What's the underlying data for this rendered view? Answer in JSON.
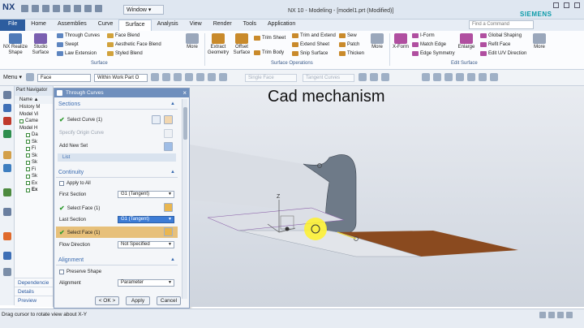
{
  "app": {
    "logo": "NX",
    "window_menu": "Window ▾",
    "title": "NX 10 - Modeling - [model1.prt (Modified)]",
    "brand": "SIEMENS",
    "search_placeholder": "Find a Command"
  },
  "tabs": [
    "File",
    "Home",
    "Assemblies",
    "Curve",
    "Surface",
    "Analysis",
    "View",
    "Render",
    "Tools",
    "Application"
  ],
  "ribbon": {
    "nx_realize": "NX Realize Shape",
    "studio": "Studio Surface",
    "through_curves": "Through Curves",
    "swept": "Swept",
    "law_ext": "Law Extension",
    "face_blend": "Face Blend",
    "aesthetic": "Aesthetic Face Blend",
    "styled_blend": "Styled Blend",
    "more1": "More",
    "extract": "Extract Geometry",
    "offset": "Offset Surface",
    "trim_sheet": "Trim Sheet",
    "trim_body": "Trim Body",
    "trim_extend": "Trim and Extend",
    "extend_sheet": "Extend Sheet",
    "snip": "Snip Surface",
    "sew": "Sew",
    "patch": "Patch",
    "thicken": "Thicken",
    "more2": "More",
    "xform": "X-Form",
    "iform": "I-Form",
    "match_edge": "Match Edge",
    "edge_sym": "Edge Symmetry",
    "enlarge": "Enlarge",
    "global_shaping": "Global Shaping",
    "refit": "Refit Face",
    "edit_uv": "Edit U/V Direction",
    "more3": "More",
    "grp_surface": "Surface",
    "grp_ops": "Surface Operations",
    "grp_edit": "Edit Surface"
  },
  "toolbar": {
    "menu": "Menu ▾",
    "filter": "Face",
    "scope": "Within Work Part O",
    "single": "Single Face",
    "tangent": "Tangent Curves"
  },
  "navigator": {
    "title": "Part Navigator",
    "col": "Name ▲",
    "rows": [
      "History M",
      "Model Vi",
      "Came",
      "Model H",
      "Da",
      "Sk",
      "Fi",
      "Sk",
      "Sk",
      "Fi",
      "Sk",
      "Ex",
      "Ex"
    ],
    "dependencies": "Dependencie",
    "details": "Details",
    "preview": "Preview"
  },
  "dialog": {
    "title": "Through Curves",
    "sections": "Sections",
    "select_curve": "Select Curve (1)",
    "specify_origin": "Specify Origin Curve",
    "add_new_set": "Add New Set",
    "list": "List",
    "continuity": "Continuity",
    "apply_all": "Apply to All",
    "first_section": "First Section",
    "first_value": "G1 (Tangent)",
    "select_face1": "Select Face (1)",
    "last_section": "Last Section",
    "last_value": "G1 (Tangent)",
    "select_face2": "Select Face (1)",
    "flow_direction": "Flow Direction",
    "flow_value": "Not Specified",
    "alignment_sec": "Alignment",
    "preserve_shape": "Preserve Shape",
    "alignment": "Alignment",
    "alignment_value": "Parameter",
    "ok": "< OK >",
    "apply": "Apply",
    "cancel": "Cancel"
  },
  "viewport": {
    "heading": "Cad mechanism",
    "axis_z": "Z"
  },
  "status": {
    "text": "Drag cursor to rotate view about X-Y"
  },
  "colors": {
    "accent": "#2d5d9f",
    "highlight": "#e7c07a",
    "sheet": "#6e7a88",
    "strip": "#8a4a1f"
  }
}
